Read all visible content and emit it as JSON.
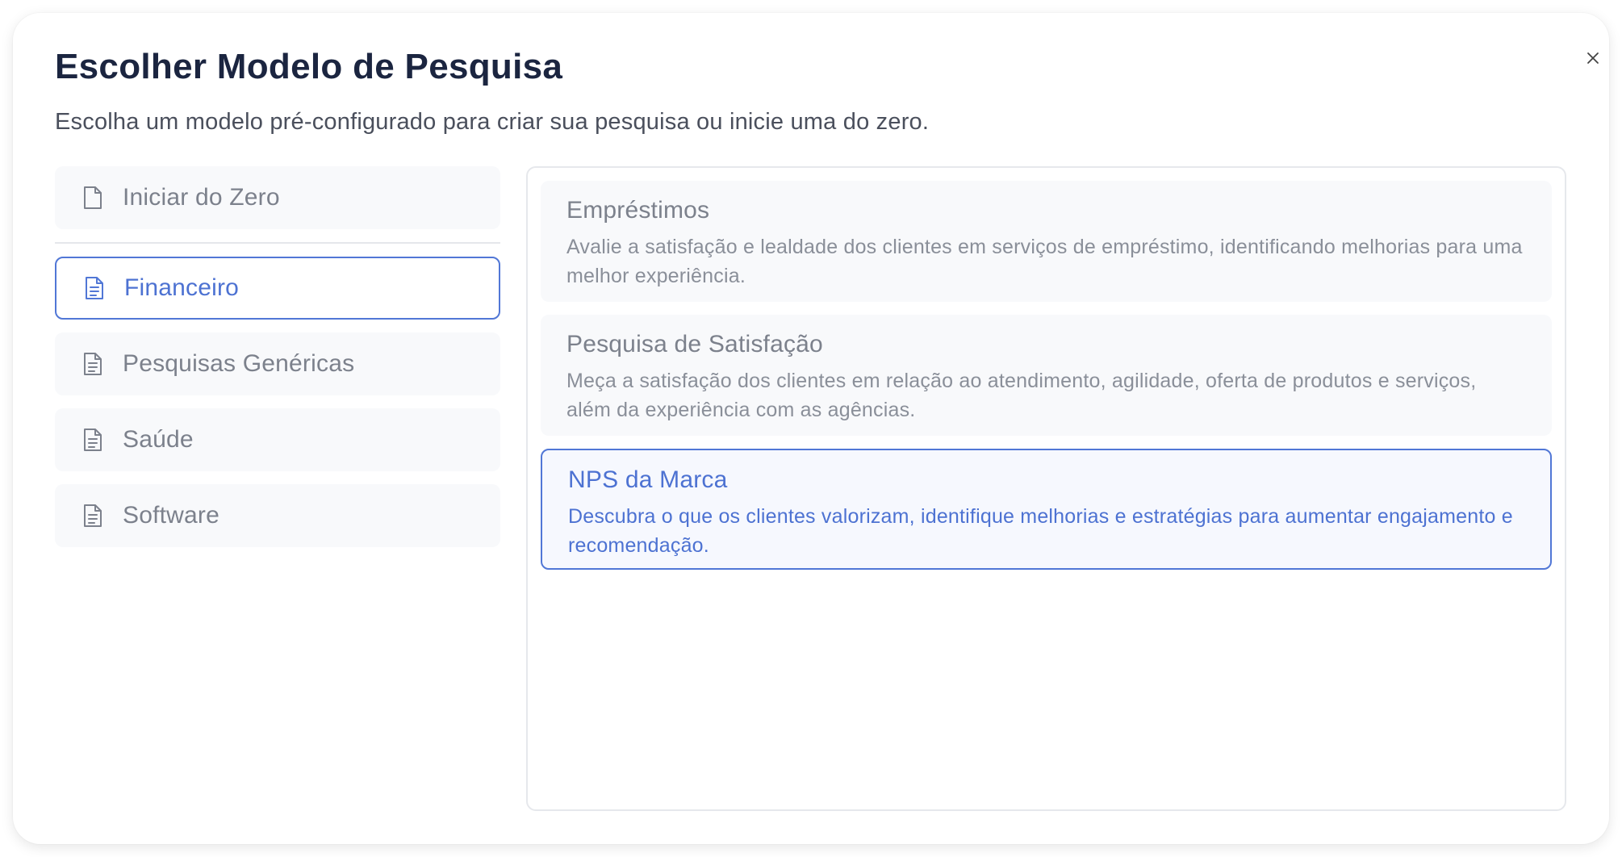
{
  "modal": {
    "title": "Escolher Modelo de Pesquisa",
    "subtitle": "Escolha um modelo pré-configurado para criar sua pesquisa ou inicie uma do zero.",
    "close_icon": "×"
  },
  "sidebar": {
    "start_blank": {
      "label": "Iniciar do Zero",
      "icon": "blank-file-icon"
    },
    "categories": [
      {
        "label": "Financeiro",
        "icon": "document-icon",
        "selected": true
      },
      {
        "label": "Pesquisas Genéricas",
        "icon": "document-icon",
        "selected": false
      },
      {
        "label": "Saúde",
        "icon": "document-icon",
        "selected": false
      },
      {
        "label": "Software",
        "icon": "document-icon",
        "selected": false
      }
    ]
  },
  "templates": [
    {
      "title": "Empréstimos",
      "description": "Avalie a satisfação e lealdade dos clientes em serviços de empréstimo, identificando melhorias para uma melhor experiência.",
      "selected": false
    },
    {
      "title": "Pesquisa de Satisfação",
      "description": "Meça a satisfação dos clientes em relação ao atendimento, agilidade, oferta de produtos e serviços, além da experiência com as agências.",
      "selected": false
    },
    {
      "title": "NPS da Marca",
      "description": "Descubra o que os clientes valorizam, identifique melhorias e estratégias para aumentar engajamento e recomendação.",
      "selected": true
    }
  ],
  "colors": {
    "accent": "#5177d6",
    "title": "#1b2540",
    "muted_text": "#7c818c",
    "item_background": "#f8f9fb"
  }
}
